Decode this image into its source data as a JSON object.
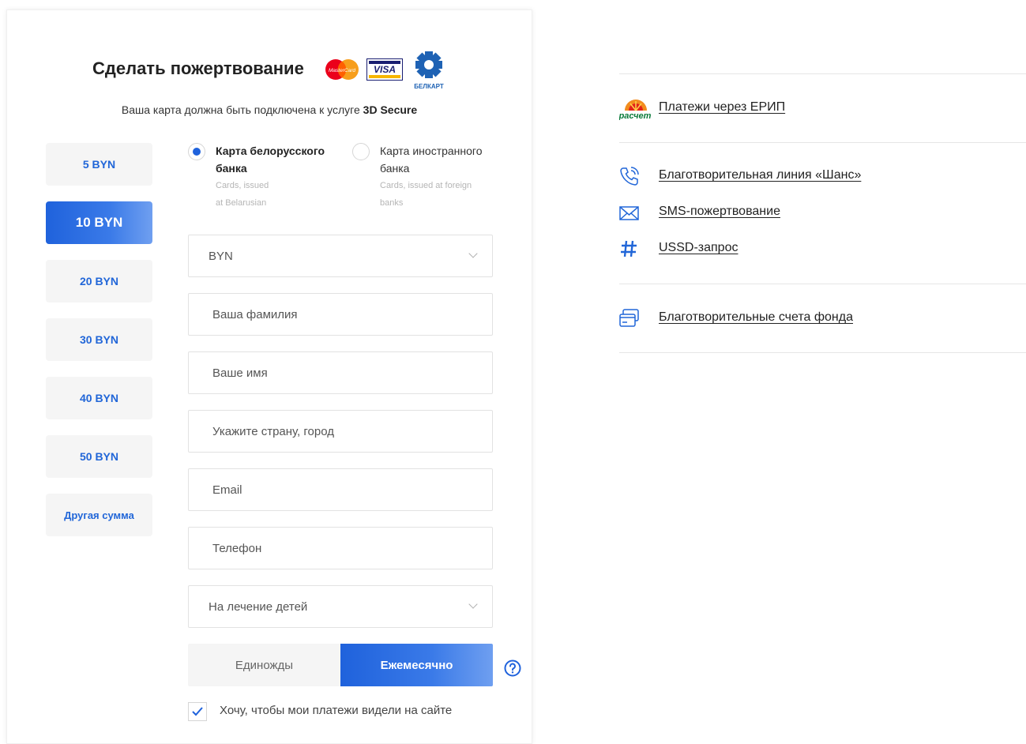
{
  "form": {
    "title": "Сделать пожертвование",
    "subtitle_prefix": "Ваша карта должна быть подключена к услуге ",
    "subtitle_strong": "3D Secure",
    "logos": {
      "mastercard_text": "MasterCard",
      "visa_text": "VISA",
      "belkart_text": "БЕЛКАРТ"
    },
    "amounts": [
      {
        "label": "5 BYN",
        "active": false
      },
      {
        "label": "10 BYN",
        "active": true
      },
      {
        "label": "20 BYN",
        "active": false
      },
      {
        "label": "30 BYN",
        "active": false
      },
      {
        "label": "40 BYN",
        "active": false
      },
      {
        "label": "50 BYN",
        "active": false
      },
      {
        "label": "Другая сумма",
        "active": false
      }
    ],
    "card_types": [
      {
        "line1": "Карта белорусского",
        "line2": "банка",
        "note1": "Cards, issued",
        "note2": "at Belarusian",
        "selected": true
      },
      {
        "line1": "Карта иностранного",
        "line2": "банка",
        "note1": "Cards, issued at foreign",
        "note2": "banks",
        "selected": false
      }
    ],
    "currency": "BYN",
    "fields": {
      "surname": "Ваша фамилия",
      "name": "Ваше имя",
      "location": "Укажите страну, город",
      "email": "Email",
      "phone": "Телефон"
    },
    "purpose": "На лечение детей",
    "frequency": {
      "once": "Единожды",
      "monthly": "Ежемесячно",
      "selected": "monthly"
    },
    "public_payments_label": "Хочу, чтобы мои платежи видели на сайте",
    "public_payments_checked": true
  },
  "side": {
    "erip_logo_text": "расчет",
    "links": {
      "erip": "Платежи через ЕРИП",
      "hotline": "Благотворительная линия «Шанс»",
      "sms": "SMS-пожертвование",
      "ussd": "USSD-запрос",
      "accounts": "Благотворительные счета фонда"
    }
  },
  "colors": {
    "accent": "#1f62dc",
    "accent_light": "#6f9ff0",
    "button_bg": "#f5f5f5"
  }
}
